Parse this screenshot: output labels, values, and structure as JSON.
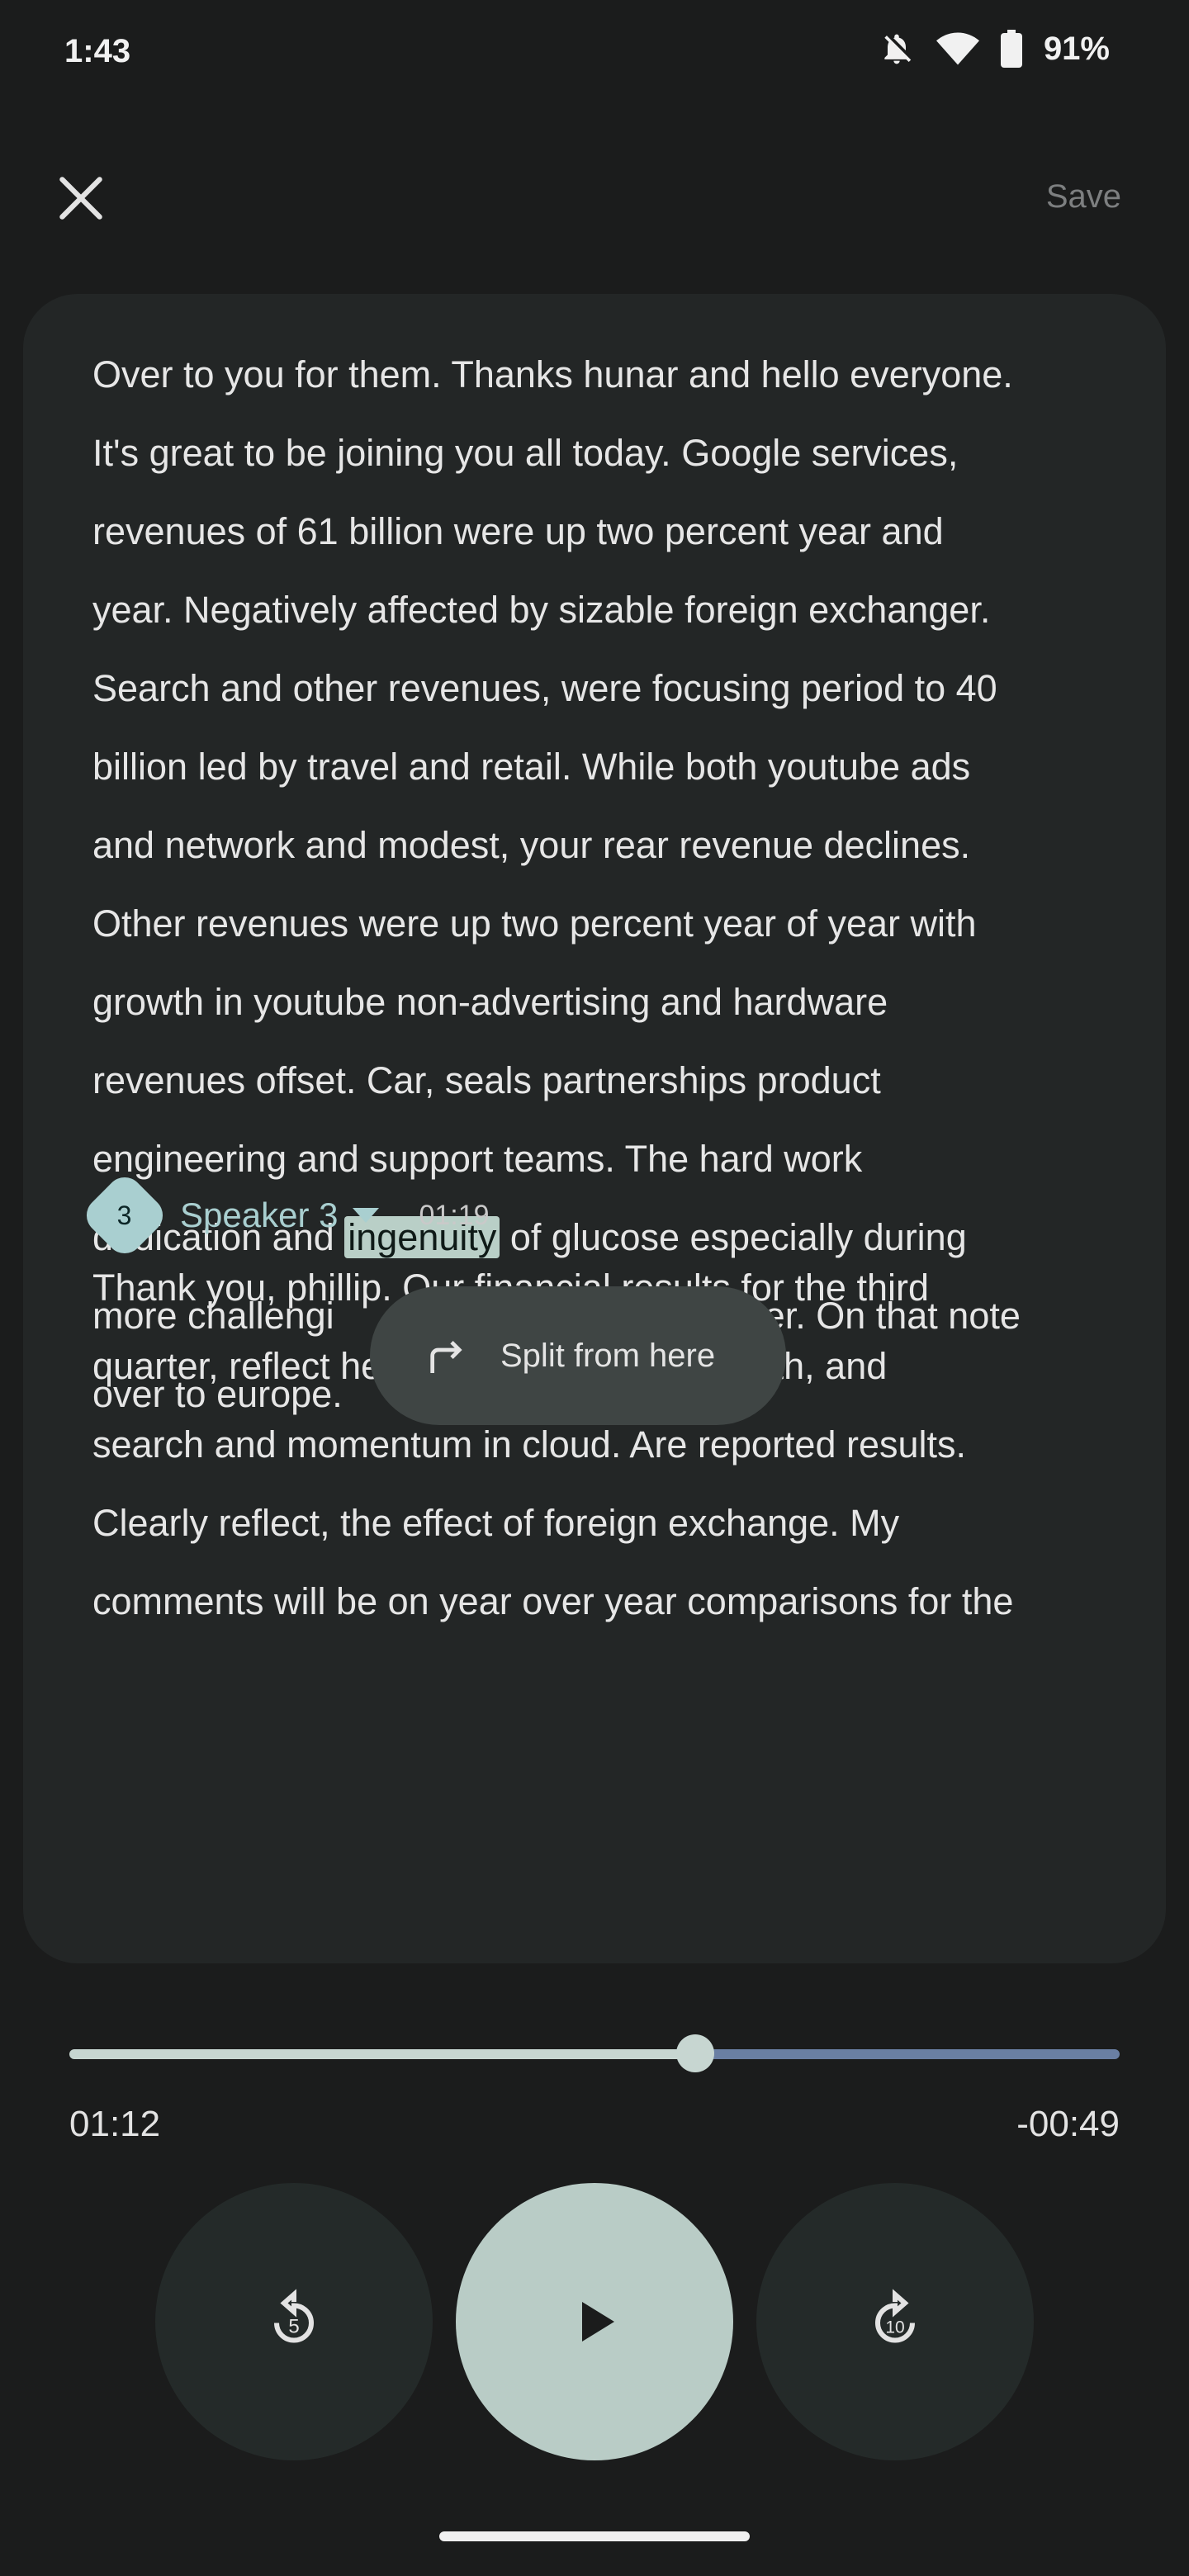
{
  "status_bar": {
    "time": "1:43",
    "battery_percent": "91%",
    "icons": [
      "notifications-off-icon",
      "wifi-icon",
      "battery-icon"
    ]
  },
  "top_bar": {
    "close_icon": "close-icon",
    "save_label": "Save"
  },
  "transcript": {
    "lines": [
      "Over to you for them. Thanks hunar and hello everyone.",
      "It's great to be joining you all today. Google services,",
      "revenues of 61 billion were up two percent year and",
      "year. Negatively affected by sizable foreign exchanger.",
      "Search and other revenues, were focusing period to 40",
      "billion led by travel and retail. While both youtube ads",
      "and network and modest, your rear revenue declines.",
      "Other revenues were up two percent year of year with",
      "growth in youtube non-advertising and hardware",
      "revenues offset. Car, seals partnerships product",
      "engineering and support teams. The hard work"
    ],
    "highlight_line": {
      "before": "dedication and ",
      "highlight": "ingenuity",
      "after": " of glucose especially during"
    },
    "line_13_left": "more challengi",
    "line_13_right": "her. On that note",
    "line_14": "over to europe."
  },
  "split_popup": {
    "icon": "split-arrow-icon",
    "label": "Split from here"
  },
  "speaker": {
    "number": "3",
    "name": "Speaker 3",
    "timestamp": "01:19"
  },
  "speaker_transcript": [
    "Thank you, phillip. Our financial results for the third",
    "quarter, reflect healthy, fundamental growth, and",
    "search and momentum in cloud. Are reported results.",
    "Clearly reflect, the effect of foreign exchange. My",
    "comments will be on year over year comparisons for the"
  ],
  "player": {
    "current_time": "01:12",
    "remaining_time": "-00:49",
    "progress": 0.596,
    "rewind_seconds": "5",
    "forward_seconds": "10",
    "colors": {
      "played": "#c7d6d1",
      "remaining": "#6a7fa3",
      "accent": "#a9cfd0"
    }
  }
}
